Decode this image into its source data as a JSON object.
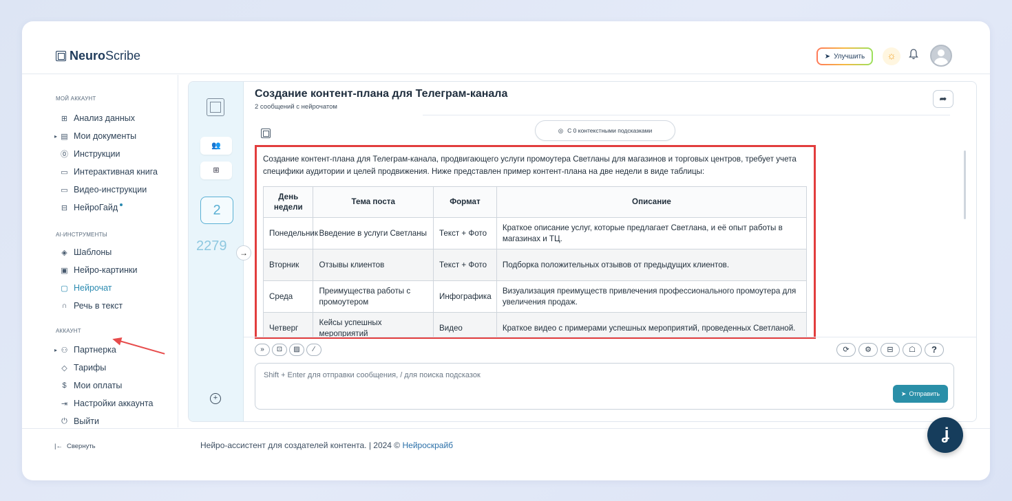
{
  "header": {
    "logo_bold": "Neuro",
    "logo_rest": "Scribe",
    "upgrade_label": "Улучшить"
  },
  "sidebar": {
    "section_account": "МОЙ АККАУНТ",
    "account_items": [
      {
        "label": "Анализ данных",
        "icon": "grid-icon"
      },
      {
        "label": "Мои документы",
        "icon": "document-icon"
      },
      {
        "label": "Инструкции",
        "icon": "question-icon"
      },
      {
        "label": "Интерактивная книга",
        "icon": "book-icon"
      },
      {
        "label": "Видео-инструкции",
        "icon": "video-icon"
      },
      {
        "label": "НейроГайд",
        "icon": "guide-icon"
      }
    ],
    "section_ai": "AI-ИНСТРУМЕНТЫ",
    "ai_items": [
      {
        "label": "Шаблоны",
        "icon": "layers-icon"
      },
      {
        "label": "Нейро-картинки",
        "icon": "image-icon"
      },
      {
        "label": "Нейрочат",
        "icon": "chat-icon"
      },
      {
        "label": "Речь в текст",
        "icon": "headphones-icon"
      }
    ],
    "section_settings": "АККАУНТ",
    "settings_items": [
      {
        "label": "Партнерка",
        "icon": "users-icon"
      },
      {
        "label": "Тарифы",
        "icon": "tag-icon"
      },
      {
        "label": "Мои оплаты",
        "icon": "dollar-icon"
      },
      {
        "label": "Настройки аккаунта",
        "icon": "settings-icon"
      },
      {
        "label": "Выйти",
        "icon": "power-icon"
      }
    ],
    "collapse_label": "Свернуть"
  },
  "chat": {
    "title": "Создание контент-плана для Телеграм-канала",
    "subtitle": "2 сообщений с нейрочатом",
    "message_count": "2",
    "token_count": "2279",
    "context_hint": "С 0 контекстными подсказками",
    "message_intro": "Создание контент-плана для Телеграм-канала, продвигающего услуги промоутера Светланы для магазинов и торговых центров, требует учета специфики аудитории и целей продвижения. Ниже представлен пример контент-плана на две недели в виде таблицы:",
    "table": {
      "headers": [
        "День недели",
        "Тема поста",
        "Формат",
        "Описание"
      ],
      "rows": [
        [
          "Понедельник",
          "Введение в услуги Светланы",
          "Текст + Фото",
          "Краткое описание услуг, которые предлагает Светлана, и её опыт работы в магазинах и ТЦ."
        ],
        [
          "Вторник",
          "Отзывы клиентов",
          "Текст + Фото",
          "Подборка положительных отзывов от предыдущих клиентов."
        ],
        [
          "Среда",
          "Преимущества работы с промоутером",
          "Инфографика",
          "Визуализация преимуществ привлечения профессионального промоутера для увеличения продаж."
        ],
        [
          "Четверг",
          "Кейсы успешных мероприятий",
          "Видео",
          "Краткое видео с примерами успешных мероприятий, проведенных Светланой."
        ]
      ]
    },
    "input_placeholder": "Shift + Enter для отправки сообщения, / для поиска подсказок",
    "send_label": "Отправить"
  },
  "footer": {
    "text": "Нейро-ассистент для создателей контента.  | 2024 © ",
    "link": "Нейроскрайб"
  },
  "colors": {
    "accent": "#2a8ab0",
    "highlight_border": "#e23d3d",
    "send_button": "#2a8fa8",
    "fab": "#163d5c"
  }
}
